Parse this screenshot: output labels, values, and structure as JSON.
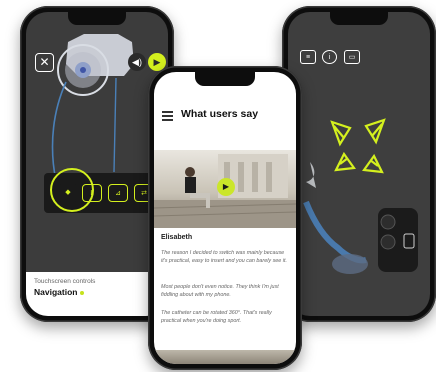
{
  "accent_color": "#d4f01e",
  "left_phone": {
    "close_icon": "close-icon",
    "sound_icon": "speaker-icon",
    "play_icon": "play-icon",
    "controls": [
      "◆",
      "Ⅱ",
      "⊿",
      "⇄"
    ],
    "nav_card": {
      "subtitle": "Touchscreen controls",
      "title": "Navigation"
    }
  },
  "middle_phone": {
    "menu_icon": "hamburger-menu-icon",
    "title": "What users say",
    "play_icon": "play-icon",
    "user_name": "Elisabeth",
    "quotes": [
      "The reason I decided to switch was mainly because it's practical, easy to insert and you can barely see it.",
      "Most people don't even notice. They think I'm just fiddling about with my phone.",
      "The catheter can be rotated 360°. That's really practical when you're doing sport."
    ]
  },
  "right_phone": {
    "icons": [
      "list-icon",
      "info-icon",
      "card-icon"
    ]
  }
}
